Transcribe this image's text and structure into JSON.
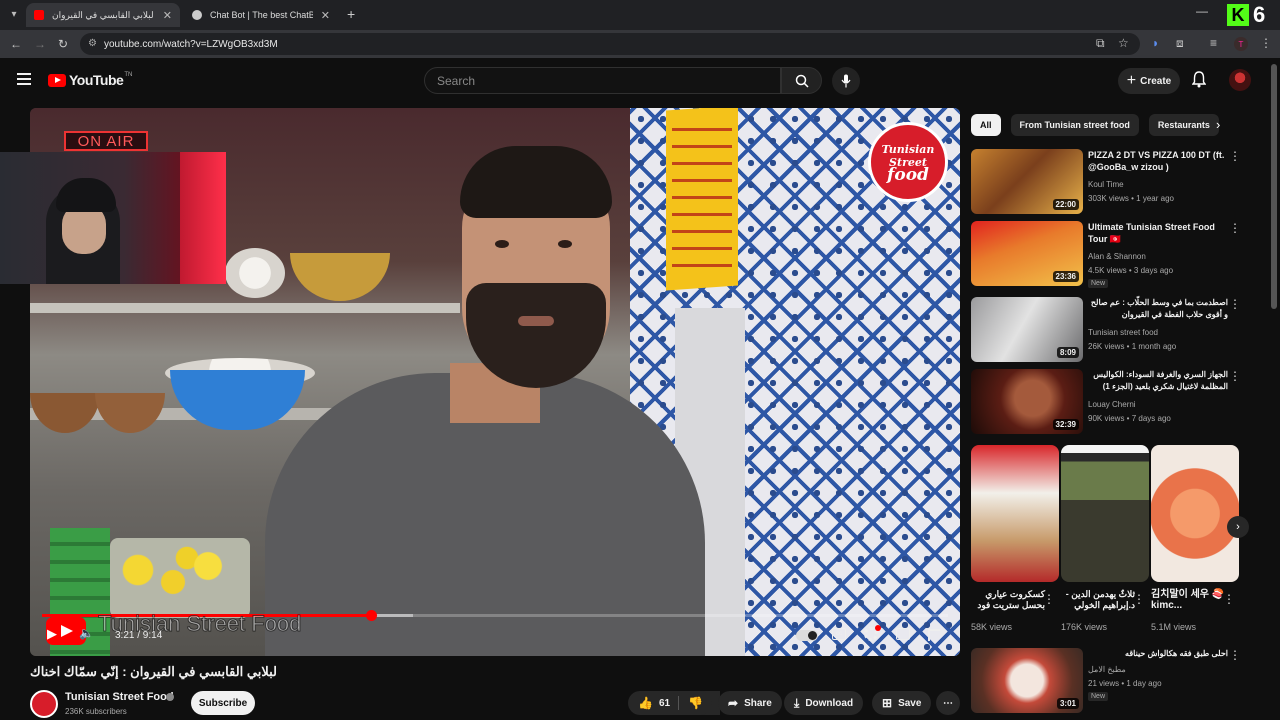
{
  "browser": {
    "tabs": [
      {
        "title": "لبلابي القابسي في القيروان",
        "active": true
      },
      {
        "title": "Chat Bot | The best ChatBot ar",
        "active": false
      }
    ],
    "url": "youtube.com/watch?v=LZWgOB3xd3M",
    "kick_count": "6",
    "kick_letter": "K",
    "profile_initial": "T"
  },
  "youtube": {
    "logo_text": "YouTube",
    "logo_suffix": "TN",
    "search_placeholder": "Search",
    "create_label": "Create"
  },
  "player": {
    "on_air": "ON AIR",
    "brand_top": "Tunisian",
    "brand_mid": "Street",
    "brand_bottom": "food",
    "watermark": "Tunisian Street Food",
    "time": "3:21 / 9:14",
    "progress_played": 0.3636,
    "progress_loaded": 0.41
  },
  "video": {
    "title": "لبلابي القابسي في القيروان : إنّي سمّاك اخناك",
    "channel": "Tunisian Street Food",
    "subscribers": "236K subscribers",
    "subscribe_label": "Subscribe",
    "likes": "61",
    "share_label": "Share",
    "download_label": "Download",
    "save_label": "Save"
  },
  "chips": [
    "All",
    "From Tunisian street food",
    "Restaurants"
  ],
  "recommendations": [
    {
      "title": "PIZZA 2 DT VS PIZZA 100 DT (ft. @GooBa_w zizou )",
      "channel": "Koul Time",
      "meta": "303K views • 1 year ago",
      "duration": "22:00",
      "new": ""
    },
    {
      "title": "Ultimate Tunisian Street Food Tour 🇹🇳",
      "channel": "Alan & Shannon",
      "meta": "4.5K views • 3 days ago",
      "duration": "23:36",
      "new": "New"
    },
    {
      "title": "اصطدمت بما في وسط الحلّاب : عم صالح و أقوى حلاب الفطة في القيروان",
      "channel": "Tunisian street food",
      "meta": "26K views • 1 month ago",
      "duration": "8:09",
      "new": ""
    },
    {
      "title": "الجهاز السري والغرفة السوداء: الكواليس المظلمة لاغتيال شكري بلعيد (الجزء 1)",
      "channel": "Louay Cherni",
      "meta": "90K views • 7 days ago",
      "duration": "32:39",
      "new": ""
    }
  ],
  "shorts": [
    {
      "title": "كسكروت عياري بحسل ستريت فود",
      "views": "58K views"
    },
    {
      "title": "ثلاثٌ يهدمن الدين - د.إبراهيم الخولي",
      "views": "176K views"
    },
    {
      "title": "김치말이 세우 🍣 kimc...",
      "views": "5.1M views"
    }
  ],
  "bottom_rec": {
    "title": "احلى طبق فقه هكالواش حيناقه",
    "channel": "مطبخ الامل",
    "meta": "21 views • 1 day ago",
    "duration": "3:01",
    "new": "New"
  },
  "colors": {
    "accent": "#ff0000",
    "kick": "#53fc18",
    "brand": "#d71d2a"
  }
}
